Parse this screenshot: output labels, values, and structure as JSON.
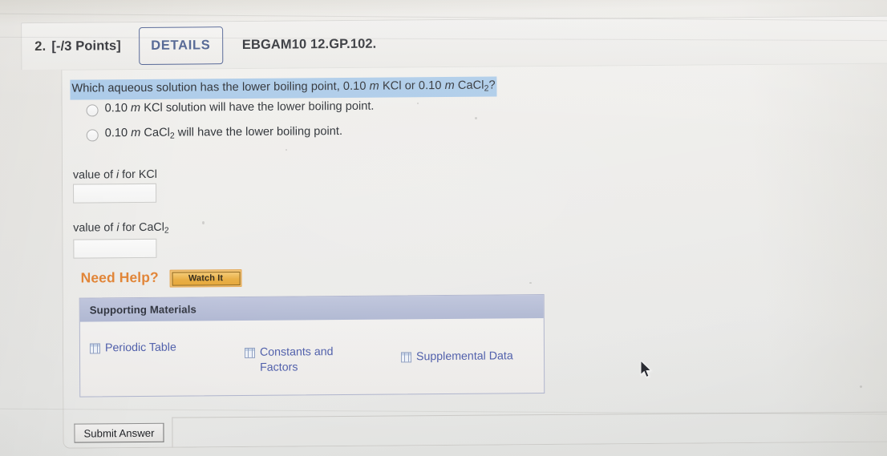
{
  "question": {
    "number": "2.",
    "points": "[-/3 Points]",
    "details_button": "DETAILS",
    "code": "EBGAM10 12.GP.102.",
    "prompt_parts": {
      "p1": "Which aqueous solution has the lower boiling point, 0.10 ",
      "m1": "m",
      "p2": " KCl or 0.10 ",
      "m2": "m",
      "p3": " CaCl",
      "sub": "2",
      "p4": "?"
    },
    "options": [
      {
        "p1": "0.10 ",
        "m": "m",
        "p2": " KCl solution will have the lower boiling point.",
        "selected": false
      },
      {
        "p1": "0.10 ",
        "m": "m",
        "p2": " CaCl",
        "sub": "2",
        "p3": " will have the lower boiling point.",
        "selected": false
      }
    ],
    "fields": [
      {
        "label_p1": "value of ",
        "label_i": "i",
        "label_p2": " for KCl",
        "label_sub": "",
        "value": "",
        "placeholder": ""
      },
      {
        "label_p1": "value of ",
        "label_i": "i",
        "label_p2": " for CaCl",
        "label_sub": "2",
        "value": "",
        "placeholder": ""
      }
    ]
  },
  "need_help": {
    "label": "Need Help?",
    "watch_button": "Watch It"
  },
  "supporting_materials": {
    "title": "Supporting Materials",
    "links": [
      {
        "label": "Periodic Table",
        "icon": "table-icon"
      },
      {
        "label": "Constants and Factors",
        "icon": "table-icon"
      },
      {
        "label": "Supplemental Data",
        "icon": "table-icon"
      }
    ]
  },
  "submit": {
    "label": "Submit Answer"
  },
  "colors": {
    "highlight": "#a9c9e8",
    "details_border": "#44578b",
    "need_help": "#e08030",
    "watch_it": "#e8ab3c",
    "sm_header": "#b4bcd8",
    "link": "#4a5aa8",
    "page_bg": "#e9e8e5"
  }
}
